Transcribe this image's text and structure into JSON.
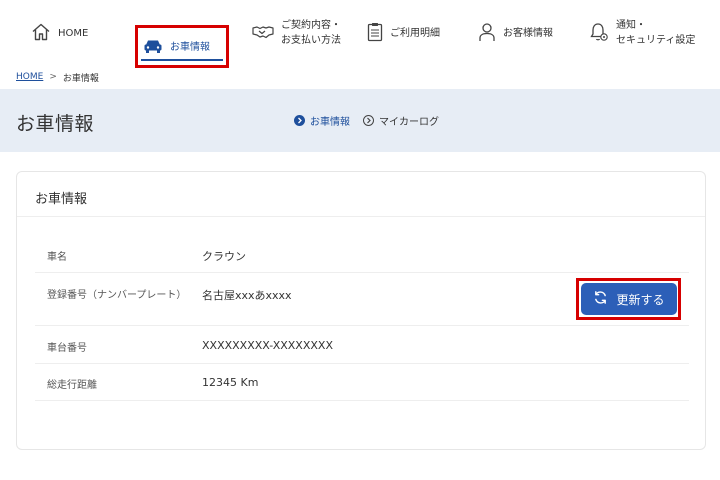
{
  "nav": {
    "home": "HOME",
    "car_info": "お車情報",
    "contract": "ご契約内容・\nお支払い方法",
    "usage": "ご利用明細",
    "customer": "お客様情報",
    "notify": "通知・\nセキュリティ設定"
  },
  "breadcrumb": {
    "home": "HOME",
    "separator": ">",
    "current": "お車情報"
  },
  "page": {
    "title": "お車情報",
    "subnav": [
      "お車情報",
      "マイカーログ"
    ]
  },
  "card": {
    "title": "お車情報",
    "rows": [
      {
        "label": "車名",
        "value": "クラウン"
      },
      {
        "label": "登録番号（ナンバープレート）",
        "value": "名古屋xxxあxxxx"
      },
      {
        "label": "車台番号",
        "value": "XXXXXXXXX-XXXXXXXX"
      },
      {
        "label": "総走行距離",
        "value": "12345 Km"
      }
    ],
    "update_button": "更新する"
  },
  "colors": {
    "accent": "#1e4f9c",
    "button": "#2c5fb8",
    "band": "#e7edf5",
    "highlight": "#d60000"
  },
  "icons": {
    "home": "home-icon",
    "car": "car-icon",
    "contract": "handshake-icon",
    "usage": "clipboard-icon",
    "customer": "person-icon",
    "notify": "bell-gear-icon",
    "refresh": "refresh-icon"
  }
}
